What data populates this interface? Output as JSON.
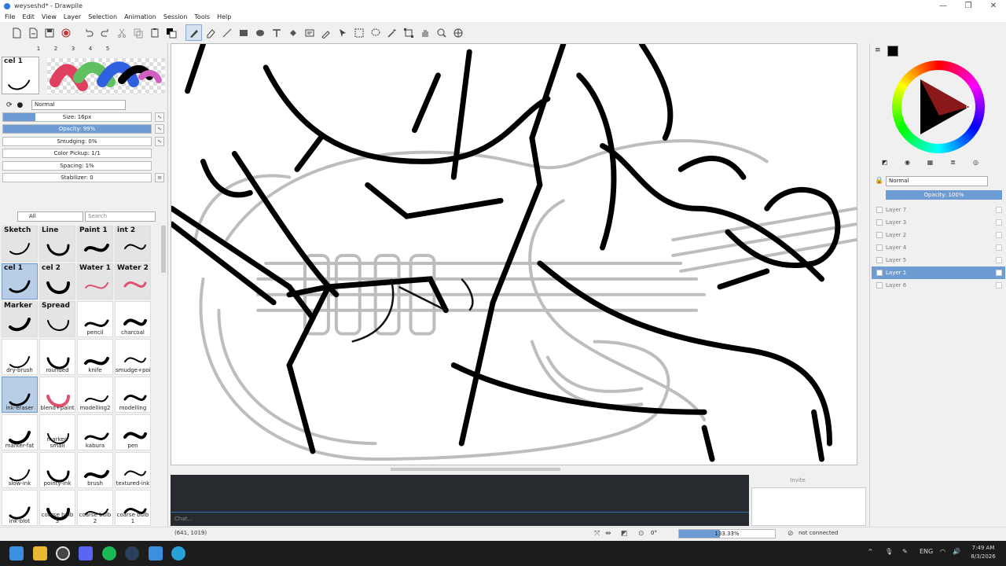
{
  "window": {
    "title": "weyseshd* - Drawpile",
    "controls": [
      "—",
      "❐",
      "✕"
    ]
  },
  "menu": [
    "File",
    "Edit",
    "View",
    "Layer",
    "Selection",
    "Animation",
    "Session",
    "Tools",
    "Help"
  ],
  "brush_slots": [
    "1",
    "2",
    "3",
    "4",
    "5"
  ],
  "brush_settings": {
    "preset_name": "cel 1",
    "blend_mode": "Normal",
    "sliders": [
      {
        "label": "Size: 16px",
        "fill": 0.22
      },
      {
        "label": "Opacity: 99%",
        "fill": 1.0,
        "selected": true
      },
      {
        "label": "Smudging: 0%",
        "fill": 0
      },
      {
        "label": "Color Pickup: 1/1",
        "fill": 0
      },
      {
        "label": "Spacing: 1%",
        "fill": 0
      },
      {
        "label": "Stabilizer: 0",
        "fill": 0
      }
    ]
  },
  "brushes": {
    "category": "All",
    "search_placeholder": "Search",
    "items": [
      {
        "top": "Sketch",
        "bottom": "",
        "style": "gray"
      },
      {
        "top": "Line",
        "bottom": "",
        "style": "gray"
      },
      {
        "top": "Paint 1",
        "bottom": "",
        "style": "gray"
      },
      {
        "top": "int 2",
        "bottom": "",
        "style": "gray"
      },
      {
        "top": "cel 1",
        "bottom": "",
        "style": "sel"
      },
      {
        "top": "cel 2",
        "bottom": "",
        "style": "gray"
      },
      {
        "top": "Water 1",
        "bottom": "",
        "style": "gray"
      },
      {
        "top": "Water 2",
        "bottom": "",
        "style": "gray"
      },
      {
        "top": "Marker",
        "bottom": "",
        "style": "gray"
      },
      {
        "top": "Spread",
        "bottom": "",
        "style": "gray"
      },
      {
        "top": "",
        "bottom": "pencil",
        "style": ""
      },
      {
        "top": "",
        "bottom": "charcoal",
        "style": ""
      },
      {
        "top": "",
        "bottom": "dry-brush",
        "style": ""
      },
      {
        "top": "",
        "bottom": "rounded",
        "style": ""
      },
      {
        "top": "",
        "bottom": "knife",
        "style": ""
      },
      {
        "top": "",
        "bottom": "smudge+point",
        "style": ""
      },
      {
        "top": "",
        "bottom": "ink-eraser",
        "style": "sel"
      },
      {
        "top": "",
        "bottom": "blend+paint",
        "style": ""
      },
      {
        "top": "",
        "bottom": "modelling2",
        "style": ""
      },
      {
        "top": "",
        "bottom": "modelling",
        "style": ""
      },
      {
        "top": "",
        "bottom": "marker-fat",
        "style": ""
      },
      {
        "top": "",
        "bottom": "marker-small",
        "style": ""
      },
      {
        "top": "",
        "bottom": "kabura",
        "style": ""
      },
      {
        "top": "",
        "bottom": "pen",
        "style": ""
      },
      {
        "top": "",
        "bottom": "slow-ink",
        "style": ""
      },
      {
        "top": "",
        "bottom": "pointy-ink",
        "style": ""
      },
      {
        "top": "",
        "bottom": "brush",
        "style": ""
      },
      {
        "top": "",
        "bottom": "textured-ink",
        "style": ""
      },
      {
        "top": "",
        "bottom": "ink-blot",
        "style": ""
      },
      {
        "top": "",
        "bottom": "coarse bulb 3",
        "style": ""
      },
      {
        "top": "",
        "bottom": "coarse bulb 2",
        "style": ""
      },
      {
        "top": "",
        "bottom": "coarse bulb 1",
        "style": ""
      },
      {
        "top": "",
        "bottom": "",
        "style": ""
      },
      {
        "top": "",
        "bottom": "",
        "style": ""
      },
      {
        "top": "",
        "bottom": "",
        "style": ""
      },
      {
        "top": "",
        "bottom": "",
        "style": ""
      }
    ]
  },
  "chat": {
    "placeholder": "Chat...",
    "invite_label": "Invite"
  },
  "layers": {
    "blend_mode": "Normal",
    "opacity_label": "Opacity: 100%",
    "items": [
      {
        "name": "Layer 7",
        "selected": false
      },
      {
        "name": "Layer 3",
        "selected": false
      },
      {
        "name": "Layer 2",
        "selected": false
      },
      {
        "name": "Layer 4",
        "selected": false
      },
      {
        "name": "Layer 5",
        "selected": false
      },
      {
        "name": "Layer 1",
        "selected": true
      },
      {
        "name": "Layer 6",
        "selected": false
      }
    ]
  },
  "status": {
    "coords": "(641, 1019)",
    "rotation": "0°",
    "zoom": "133.33%",
    "connection": "not connected"
  },
  "taskbar": {
    "lang": "ENG",
    "time": "7:49 AM",
    "date": "8/3/2026"
  },
  "colors": {
    "accent": "#6d9bd2",
    "chat_bg": "#272b30",
    "taskbar_bg": "#1c1c1c"
  }
}
